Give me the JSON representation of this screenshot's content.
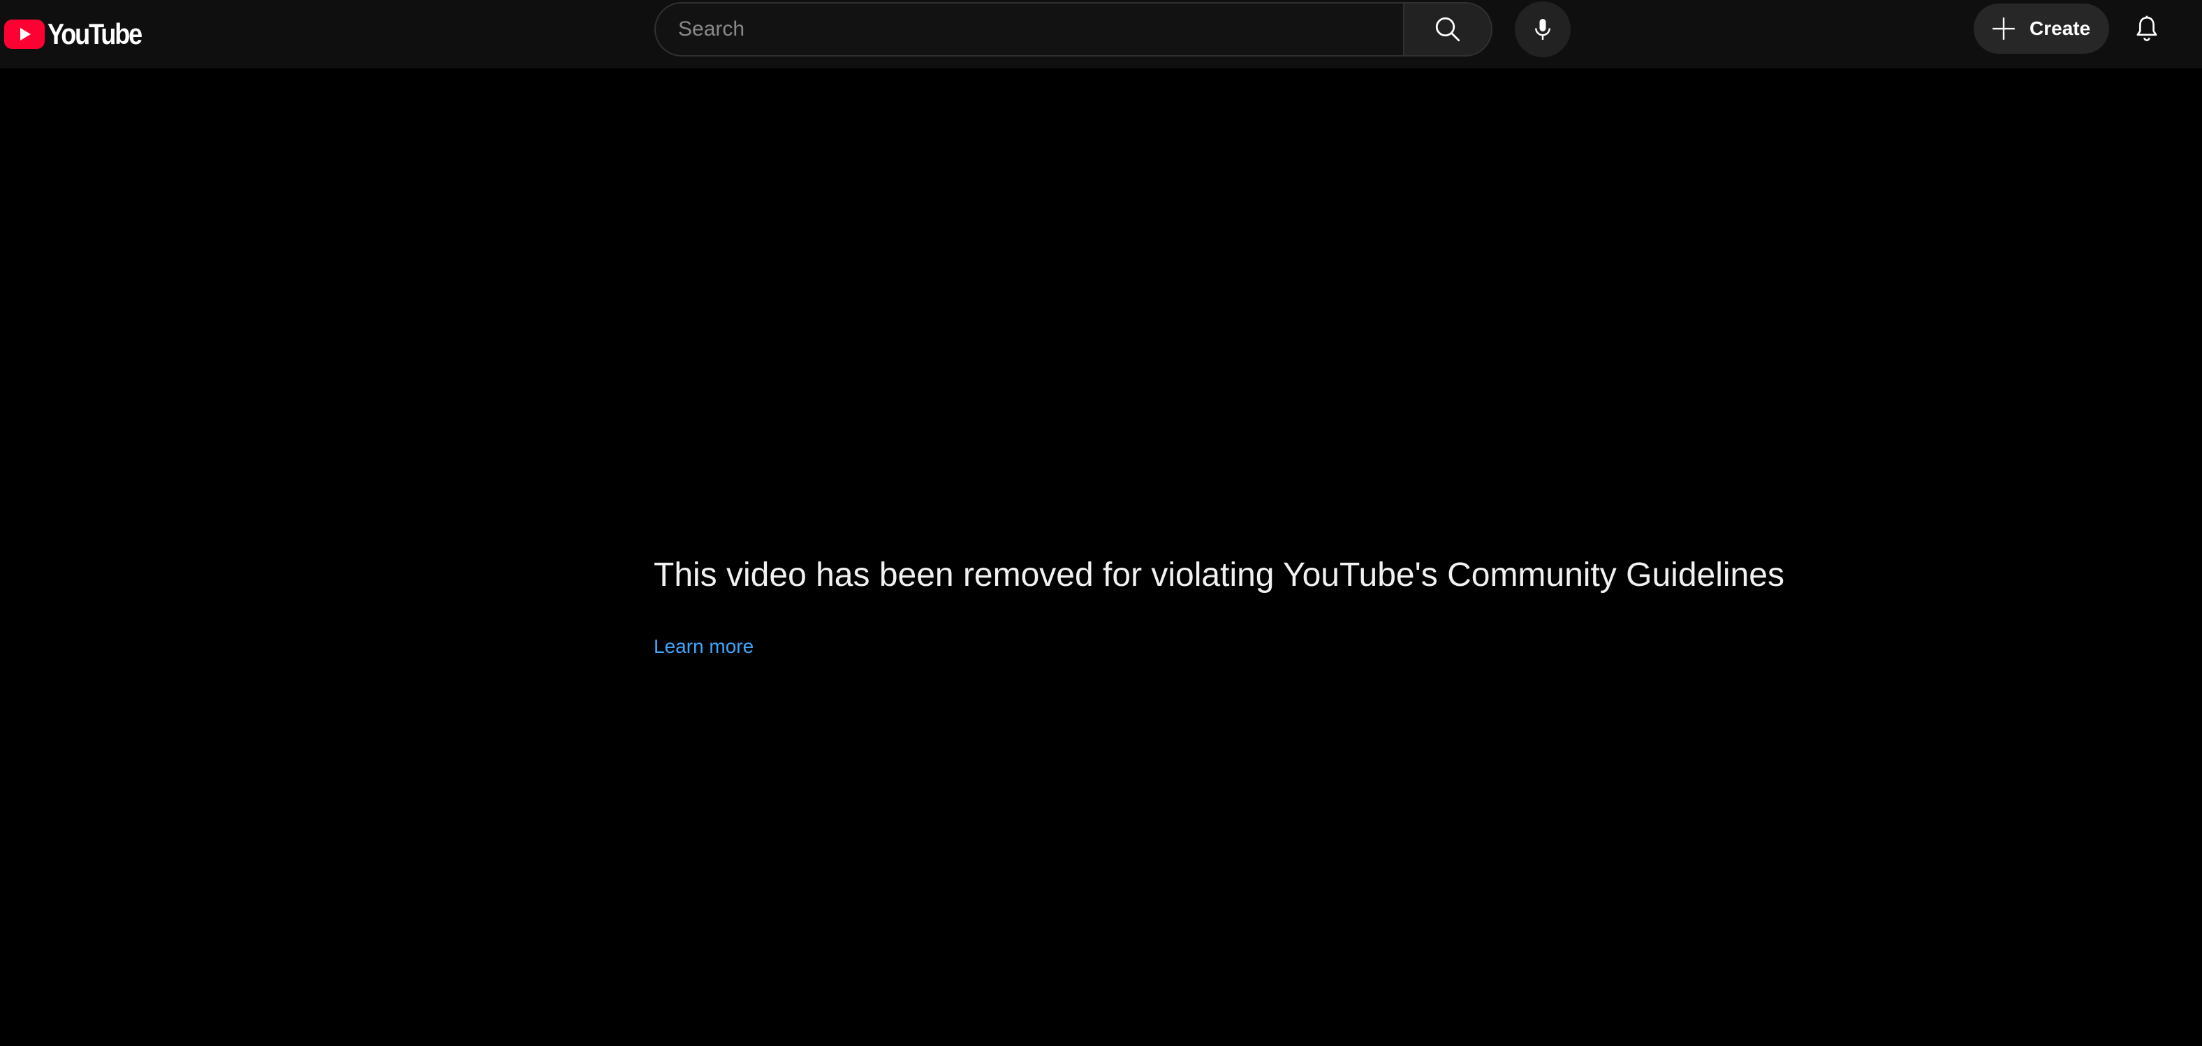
{
  "header": {
    "logo_text": "YouTube",
    "search": {
      "placeholder": "Search",
      "value": ""
    },
    "create_label": "Create"
  },
  "main": {
    "message": "This video has been removed for violating YouTube's Community Guidelines",
    "learn_more": "Learn more"
  },
  "icons": {
    "logo": "youtube-play-logo-icon",
    "search": "search-icon",
    "mic": "microphone-icon",
    "create": "plus-icon",
    "notifications": "bell-icon"
  },
  "colors": {
    "background": "#000000",
    "header_background": "#0f0f0f",
    "brand_red": "#ff0033",
    "link_blue": "#3ea6ff",
    "text_primary": "#f1f1f1"
  }
}
